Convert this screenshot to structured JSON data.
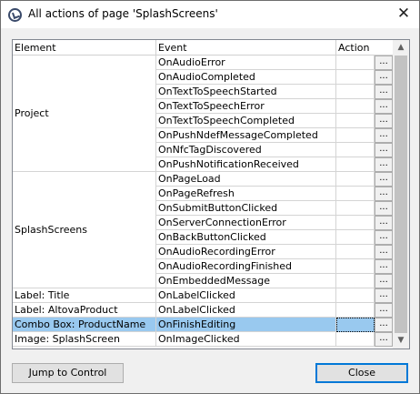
{
  "window": {
    "title": "All actions of page 'SplashScreens'",
    "close_glyph": "✕",
    "app_icon": "altova-app-icon"
  },
  "table": {
    "headers": {
      "element": "Element",
      "event": "Event",
      "action": "Action"
    },
    "ellipsis_label": "...",
    "groups": [
      {
        "element": "Project",
        "events": [
          "OnAudioError",
          "OnAudioCompleted",
          "OnTextToSpeechStarted",
          "OnTextToSpeechError",
          "OnTextToSpeechCompleted",
          "OnPushNdefMessageCompleted",
          "OnNfcTagDiscovered",
          "OnPushNotificationReceived"
        ]
      },
      {
        "element": "SplashScreens",
        "events": [
          "OnPageLoad",
          "OnPageRefresh",
          "OnSubmitButtonClicked",
          "OnServerConnectionError",
          "OnBackButtonClicked",
          "OnAudioRecordingError",
          "OnAudioRecordingFinished",
          "OnEmbeddedMessage"
        ]
      },
      {
        "element": "Label: Title",
        "events": [
          "OnLabelClicked"
        ]
      },
      {
        "element": "Label: AltovaProduct",
        "events": [
          "OnLabelClicked"
        ]
      },
      {
        "element": "Combo Box: ProductName",
        "events": [
          "OnFinishEditing"
        ],
        "selected": true
      },
      {
        "element": "Image: SplashScreen",
        "events": [
          "OnImageClicked"
        ]
      }
    ]
  },
  "scrollbar": {
    "up_glyph": "▲",
    "down_glyph": "▼"
  },
  "buttons": {
    "jump": "Jump to Control",
    "close": "Close"
  },
  "colors": {
    "selection": "#99c9ef",
    "default_button_border": "#0078d7"
  }
}
